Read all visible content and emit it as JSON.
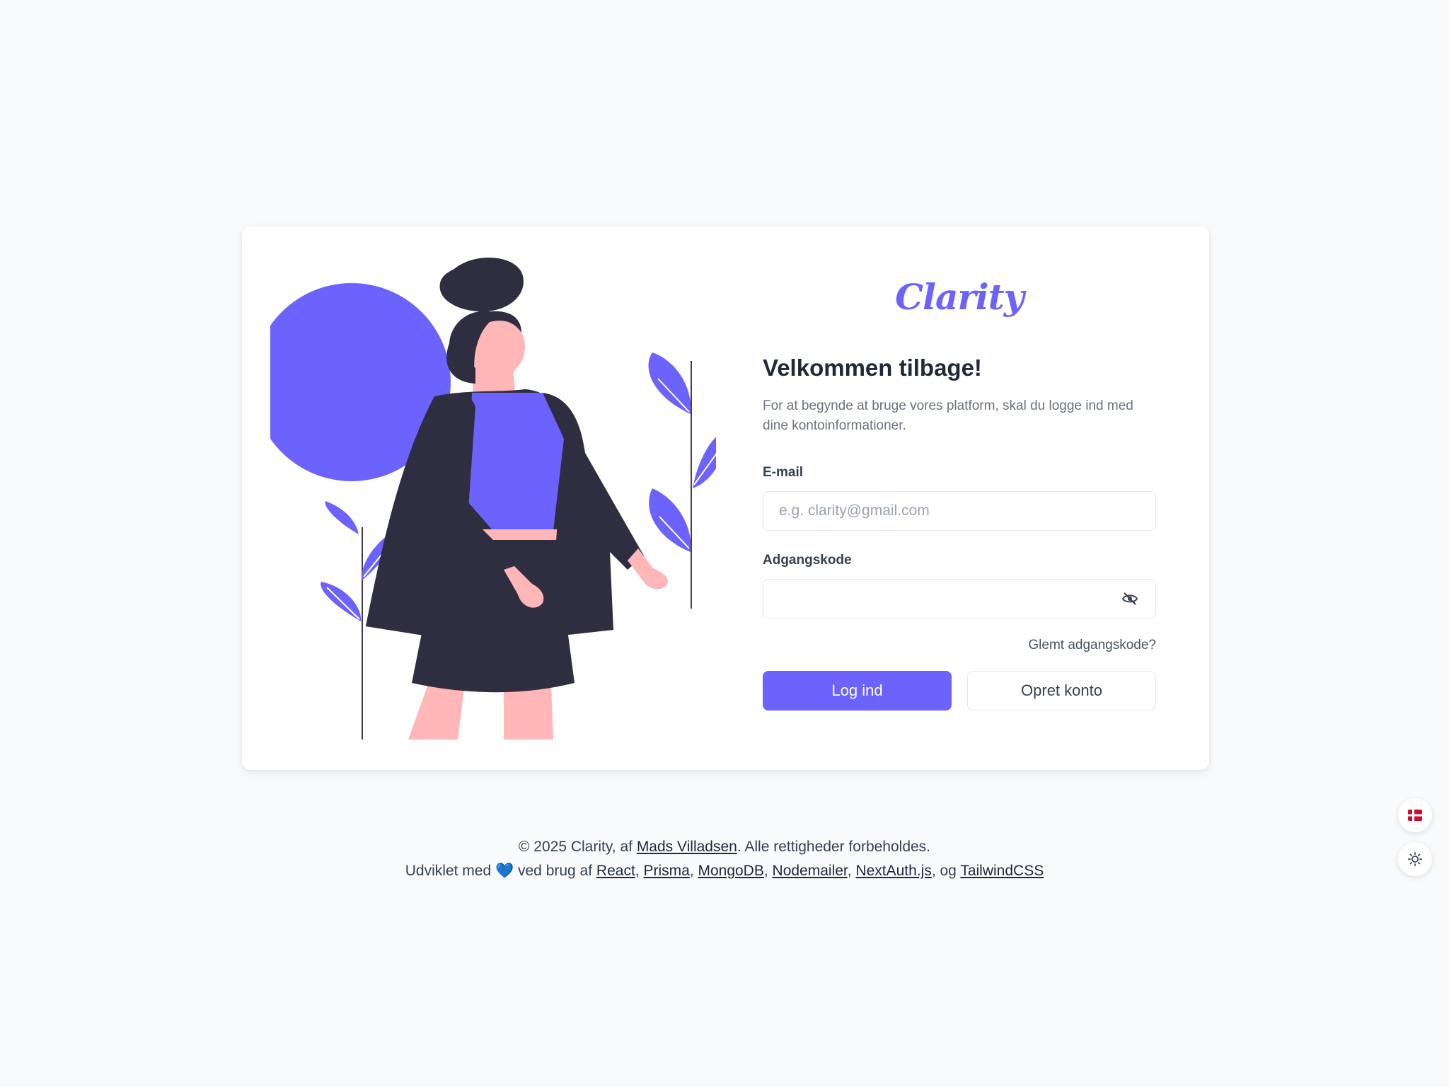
{
  "brand": {
    "logo_text": "Clarity",
    "accent_color": "#6c63ff"
  },
  "login": {
    "title": "Velkommen tilbage!",
    "subtitle": "For at begynde at bruge vores platform, skal du logge ind med dine kontoinformationer.",
    "email_label": "E-mail",
    "email_placeholder": "e.g. clarity@gmail.com",
    "email_value": "",
    "password_label": "Adgangskode",
    "password_value": "",
    "forgot_link": "Glemt adgangskode?",
    "login_button": "Log ind",
    "register_button": "Opret konto"
  },
  "footer": {
    "copyright": "© 2025 Clarity, af",
    "author_link": "Mads Villadsen",
    "rights": ". Alle rettigheder forbeholdes.",
    "made_with": "Udviklet med",
    "heart": "💙",
    "using": "ved brug af",
    "tech_react": "React",
    "tech_prisma": "Prisma",
    "tech_mongodb": "MongoDB",
    "tech_nodemailer": "Nodemailer",
    "tech_nextauth": "NextAuth.js",
    "og": ", og",
    "tech_tailwind": "TailwindCSS"
  },
  "icons": {
    "password_toggle": "eye-slash-icon",
    "language": "danish-flag-icon",
    "theme": "sun-icon"
  }
}
